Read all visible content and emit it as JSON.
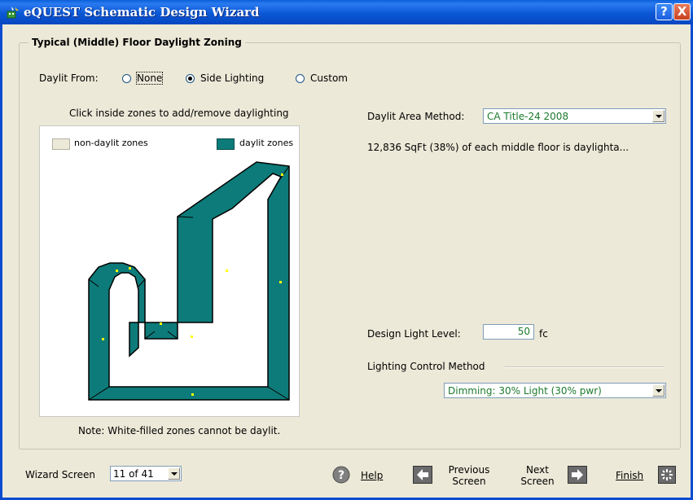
{
  "window": {
    "title": "eQUEST Schematic Design Wizard",
    "help_btn": "?",
    "close_btn": "X"
  },
  "panel": {
    "title": "Typical (Middle) Floor Daylight Zoning"
  },
  "daylit_from": {
    "label": "Daylit From:",
    "options": [
      {
        "label": "None",
        "selected": false
      },
      {
        "label": "Side Lighting",
        "selected": true
      },
      {
        "label": "Custom",
        "selected": false
      }
    ]
  },
  "diagram": {
    "instruction": "Click inside zones to add/remove daylighting",
    "legend_nondaylit": "non-daylit zones",
    "legend_daylit": "daylit zones",
    "note": "Note:  White-filled zones cannot be daylit.",
    "colors": {
      "daylit": "#0d7b79",
      "nondaylit": "#ece9d8",
      "point": "#ffff00"
    }
  },
  "daylit_area": {
    "label": "Daylit Area Method:",
    "value": "CA Title-24 2008",
    "summary": "12,836 SqFt (38%) of each middle floor is daylighta..."
  },
  "design_light": {
    "label": "Design Light Level:",
    "value": "50",
    "unit": "fc"
  },
  "lighting_control": {
    "label": "Lighting Control Method",
    "value": "Dimming: 30% Light (30% pwr)"
  },
  "footer": {
    "wizard_label": "Wizard Screen",
    "wizard_value": "11 of 41",
    "help": "Help",
    "previous_line1": "Previous",
    "previous_line2": "Screen",
    "next_line1": "Next",
    "next_line2": "Screen",
    "finish": "Finish"
  }
}
